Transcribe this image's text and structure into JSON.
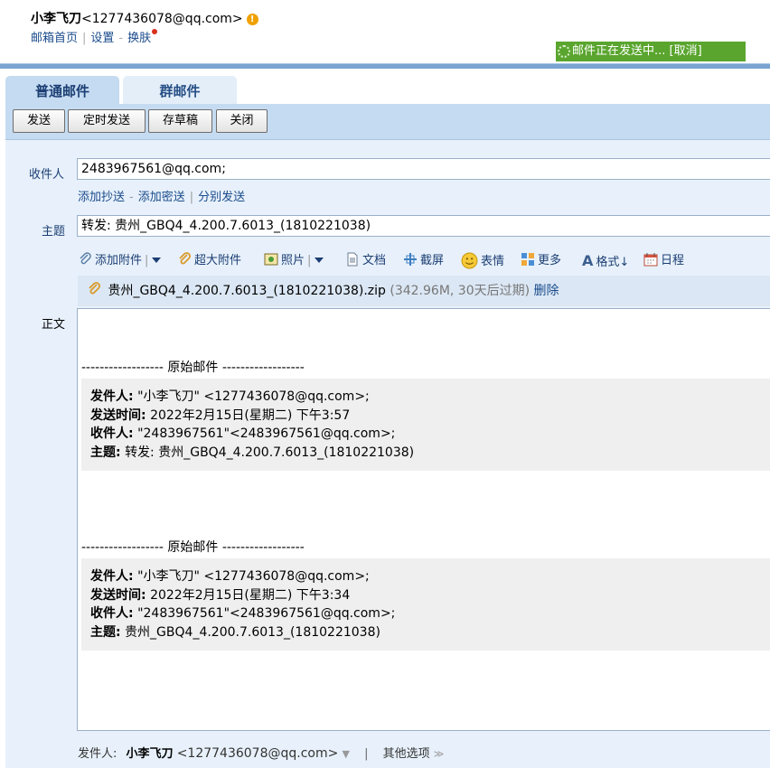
{
  "account": {
    "name": "小李飞刀",
    "email": "<1277436078@qq.com>",
    "links": {
      "home": "邮箱首页",
      "settings": "设置",
      "skin": "换肤"
    }
  },
  "sending_status": "邮件正在发送中... [取消]",
  "tabs": {
    "normal": "普通邮件",
    "group": "群邮件"
  },
  "toolbar": {
    "send": "发送",
    "scheduled": "定时发送",
    "draft": "存草稿",
    "close": "关闭"
  },
  "compose": {
    "to_label": "收件人",
    "to_value": "2483967561@qq.com;",
    "cc_links": {
      "add_cc": "添加抄送",
      "add_bcc": "添加密送",
      "separate": "分别发送"
    },
    "subject_label": "主题",
    "subject_value": "转发: 贵州_GBQ4_4.200.7.6013_(1810221038)",
    "attach_toolbar": {
      "add_attachment": "添加附件",
      "large_attachment": "超大附件",
      "photo": "照片",
      "doc": "文档",
      "screenshot": "截屏",
      "emoji": "表情",
      "more": "更多",
      "format": "格式↓",
      "calendar": "日程"
    },
    "attachment": {
      "filename": "贵州_GBQ4_4.200.7.6013_(1810221038).zip",
      "meta": "(342.96M, 30天后过期)",
      "delete": "删除"
    },
    "body_label": "正文",
    "body": {
      "divider1": "------------------ 原始邮件 ------------------",
      "quote1": {
        "from_label": "发件人:",
        "from_value": "\"小李飞刀\" <1277436078@qq.com>;",
        "time_label": "发送时间:",
        "time_value": "2022年2月15日(星期二) 下午3:57",
        "to_label": "收件人:",
        "to_value": "\"2483967561\"<2483967561@qq.com>;",
        "subject_label": "主题:",
        "subject_value": "转发: 贵州_GBQ4_4.200.7.6013_(1810221038)"
      },
      "divider2": "------------------ 原始邮件 ------------------",
      "quote2": {
        "from_label": "发件人:",
        "from_value": "\"小李飞刀\" <1277436078@qq.com>;",
        "time_label": "发送时间:",
        "time_value": "2022年2月15日(星期二) 下午3:34",
        "to_label": "收件人:",
        "to_value": "\"2483967561\"<2483967561@qq.com>;",
        "subject_label": "主题:",
        "subject_value": "贵州_GBQ4_4.200.7.6013_(1810221038)"
      }
    },
    "footer": {
      "sender_label": "发件人:",
      "sender_name": "小李飞刀",
      "sender_email": "<1277436078@qq.com>",
      "other_options": "其他选项"
    }
  },
  "colors": {
    "accent": "#1b3e73",
    "sending_green": "#5aa52e",
    "toolbar_bg": "#c5dbf1"
  }
}
